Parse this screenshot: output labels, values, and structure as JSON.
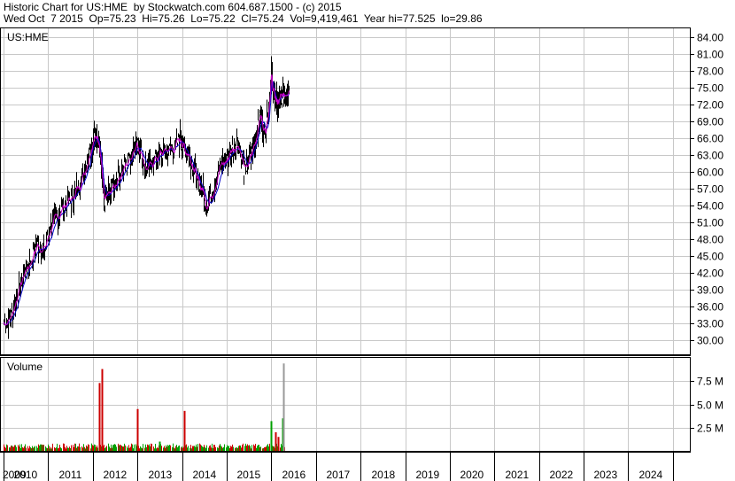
{
  "header": {
    "line1": "Historic Chart for US:HME  by Stockwatch.com 604.687.1500 - (c) 2015",
    "line2": "Wed Oct  7 2015  Op=75.23  Hi=75.26  Lo=75.22  Cl=75.24  Vol=9,419,461  Year hi=77.525  lo=29.86"
  },
  "price_panel": {
    "label": "US:HME"
  },
  "volume_panel": {
    "label": "Volume"
  },
  "colors": {
    "price_bar": "#000000",
    "ma_short": "#cc00cc",
    "ma_long": "#0000cc",
    "vol_up": "#00a000",
    "vol_down": "#cc0000",
    "vol_latest": "#999999",
    "grid": "#c8c8c8"
  },
  "chart_data": [
    {
      "type": "line",
      "title": "Historic Chart for US:HME",
      "xlabel": "",
      "ylabel": "",
      "x_ticks": [
        "2009",
        "2010",
        "2011",
        "2012",
        "2013",
        "2014",
        "2015",
        "2016",
        "2017",
        "2018",
        "2019",
        "2020",
        "2021",
        "2022",
        "2023",
        "2024"
      ],
      "y_ticks": [
        "30.00",
        "33.00",
        "36.00",
        "39.00",
        "42.00",
        "45.00",
        "48.00",
        "51.00",
        "54.00",
        "57.00",
        "60.00",
        "63.00",
        "66.00",
        "69.00",
        "72.00",
        "75.00",
        "78.00",
        "81.00",
        "84.00"
      ],
      "xlim": [
        2009.0,
        2024.4
      ],
      "ylim": [
        27.5,
        85.5
      ],
      "grid": true,
      "series": [
        {
          "values_approx": true,
          "x": [
            2009.0,
            2009.15,
            2009.3,
            2009.45,
            2009.6,
            2009.75,
            2009.9,
            2010.05,
            2010.2,
            2010.35,
            2010.5,
            2010.65,
            2010.8,
            2010.95,
            2011.0,
            2011.1,
            2011.15,
            2011.2,
            2011.25,
            2011.35,
            2011.5,
            2011.65,
            2011.8,
            2011.95,
            2012.05,
            2012.2,
            2012.35,
            2012.5,
            2012.65,
            2012.8,
            2012.95,
            2013.05,
            2013.15,
            2013.25,
            2013.35,
            2013.45,
            2013.55,
            2013.7,
            2013.85,
            2014.0,
            2014.1,
            2014.25,
            2014.4,
            2014.55,
            2014.65,
            2014.75,
            2014.85,
            2014.95,
            2015.0,
            2015.05,
            2015.1,
            2015.15,
            2015.2,
            2015.3,
            2015.4
          ],
          "close": [
            33,
            34,
            38,
            42,
            44,
            47,
            46,
            50,
            52,
            54,
            55,
            57,
            60,
            64,
            65,
            67,
            64,
            60,
            55,
            56,
            58,
            60,
            62,
            65,
            64,
            60,
            62,
            63,
            64,
            64,
            66,
            64,
            63,
            61,
            58,
            57,
            54,
            57,
            61,
            62,
            64,
            65,
            60,
            63,
            66,
            70,
            67,
            72,
            77,
            74,
            73,
            72,
            73,
            74,
            75
          ]
        }
      ]
    },
    {
      "type": "bar",
      "title": "Volume",
      "y_ticks": [
        "2.5 M",
        "5.0 M",
        "7.5 M"
      ],
      "ylim": [
        0,
        10.0
      ],
      "unit": "M",
      "values_approx": true,
      "spikes": [
        {
          "x": 2011.2,
          "value": 8.8,
          "dir": "down"
        },
        {
          "x": 2011.15,
          "value": 7.3,
          "dir": "down"
        },
        {
          "x": 2012.0,
          "value": 4.5,
          "dir": "down"
        },
        {
          "x": 2013.05,
          "value": 4.3,
          "dir": "down"
        },
        {
          "x": 2012.5,
          "value": 1.0,
          "dir": "up"
        },
        {
          "x": 2015.0,
          "value": 3.2,
          "dir": "up"
        },
        {
          "x": 2015.1,
          "value": 2.0,
          "dir": "down"
        },
        {
          "x": 2015.15,
          "value": 1.5,
          "dir": "down"
        },
        {
          "x": 2015.25,
          "value": 3.5,
          "dir": "up"
        },
        {
          "x": 2015.28,
          "value": 9.4,
          "dir": "latest"
        }
      ]
    }
  ]
}
